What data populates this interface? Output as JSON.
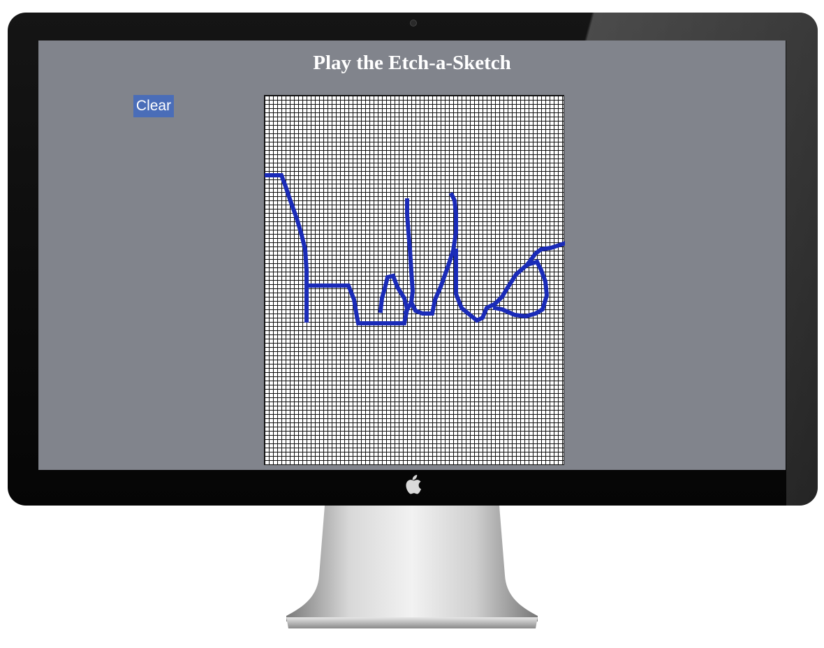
{
  "page": {
    "title": "Play the Etch-a-Sketch",
    "clear_label": "Clear"
  },
  "sketch": {
    "ink_color": "#1a2bb8",
    "cell_color": "#ffffff",
    "grid_line_color": "#111111"
  },
  "device": {
    "logo_icon": "apple-logo-icon"
  }
}
